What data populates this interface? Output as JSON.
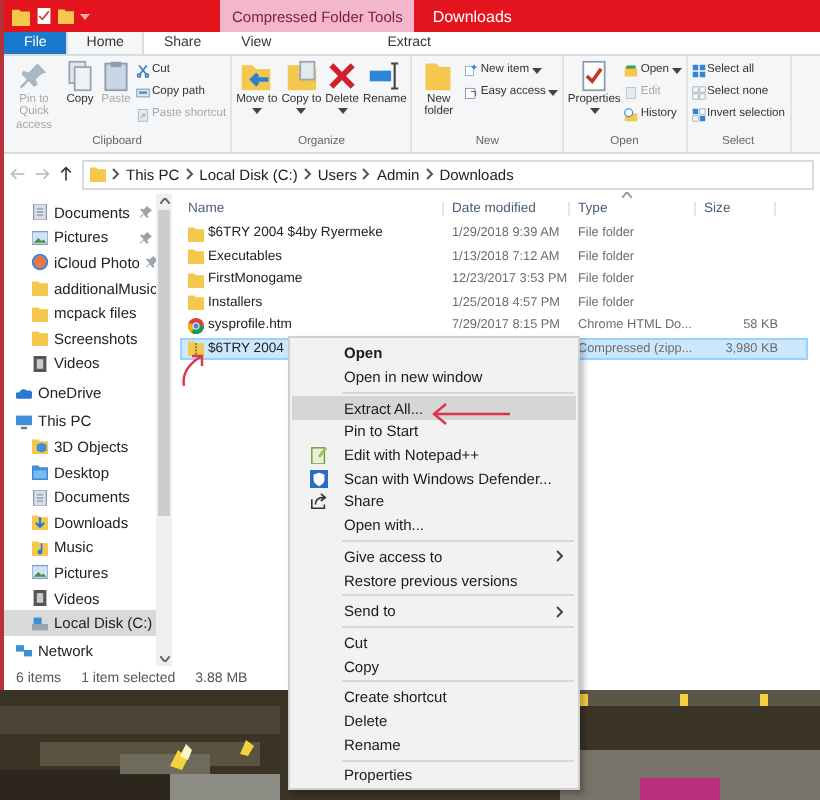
{
  "title_bar": {
    "context_tab": "Compressed Folder Tools",
    "title": "Downloads"
  },
  "ribbon_tabs": [
    {
      "label": "File",
      "kind": "file",
      "selected": false
    },
    {
      "label": "Home",
      "kind": "tab",
      "selected": true
    },
    {
      "label": "Share",
      "kind": "tab",
      "selected": false
    },
    {
      "label": "View",
      "kind": "tab",
      "selected": false
    },
    {
      "label": "Extract",
      "kind": "contextual",
      "selected": false
    }
  ],
  "ribbon_groups": [
    {
      "label": "Clipboard",
      "commands": [
        {
          "label": "Pin to Quick access",
          "kind": "large",
          "disabled": true,
          "dropdown": false
        },
        {
          "label": "Copy",
          "kind": "large",
          "disabled": false,
          "dropdown": false
        },
        {
          "label": "Paste",
          "kind": "large",
          "disabled": true,
          "dropdown": false
        },
        {
          "label": "Cut",
          "kind": "small",
          "disabled": false,
          "dropdown": false
        },
        {
          "label": "Copy path",
          "kind": "small",
          "disabled": false,
          "dropdown": false
        },
        {
          "label": "Paste shortcut",
          "kind": "small",
          "disabled": true,
          "dropdown": false
        }
      ]
    },
    {
      "label": "Organize",
      "commands": [
        {
          "label": "Move to",
          "kind": "large",
          "disabled": false,
          "dropdown": true
        },
        {
          "label": "Copy to",
          "kind": "large",
          "disabled": false,
          "dropdown": true
        },
        {
          "label": "Delete",
          "kind": "large",
          "disabled": false,
          "dropdown": true
        },
        {
          "label": "Rename",
          "kind": "large",
          "disabled": false,
          "dropdown": false
        }
      ]
    },
    {
      "label": "New",
      "commands": [
        {
          "label": "New folder",
          "kind": "large",
          "disabled": false,
          "dropdown": false
        },
        {
          "label": "New item",
          "kind": "small",
          "disabled": false,
          "dropdown": true
        },
        {
          "label": "Easy access",
          "kind": "small",
          "disabled": false,
          "dropdown": true
        }
      ]
    },
    {
      "label": "Open",
      "commands": [
        {
          "label": "Properties",
          "kind": "large",
          "disabled": false,
          "dropdown": true
        },
        {
          "label": "Open",
          "kind": "small",
          "disabled": false,
          "dropdown": true
        },
        {
          "label": "Edit",
          "kind": "small",
          "disabled": true,
          "dropdown": false
        },
        {
          "label": "History",
          "kind": "small",
          "disabled": false,
          "dropdown": false
        }
      ]
    },
    {
      "label": "Select",
      "commands": [
        {
          "label": "Select all",
          "kind": "small",
          "disabled": false,
          "dropdown": false
        },
        {
          "label": "Select none",
          "kind": "small",
          "disabled": false,
          "dropdown": false
        },
        {
          "label": "Invert selection",
          "kind": "small",
          "disabled": false,
          "dropdown": false
        }
      ]
    }
  ],
  "address_bar": {
    "nav_buttons": [
      {
        "kind": "back",
        "disabled": true
      },
      {
        "kind": "forward",
        "disabled": true
      },
      {
        "kind": "up",
        "disabled": false
      }
    ],
    "path": [
      "This PC",
      "Local Disk (C:)",
      "Users",
      "Admin",
      "Downloads"
    ]
  },
  "nav_pane": {
    "quick_access": [
      {
        "label": "Documents",
        "kind": "documents",
        "pinned": true,
        "selected": false
      },
      {
        "label": "Pictures",
        "kind": "pictures",
        "pinned": true,
        "selected": false
      },
      {
        "label": "iCloud Photo",
        "kind": "cloud",
        "pinned": true,
        "selected": false
      },
      {
        "label": "additionalMusic",
        "kind": "folder",
        "pinned": false,
        "selected": false
      },
      {
        "label": "mcpack files",
        "kind": "folder",
        "pinned": false,
        "selected": false
      },
      {
        "label": "Screenshots",
        "kind": "folder",
        "pinned": false,
        "selected": false
      },
      {
        "label": "Videos",
        "kind": "videos",
        "pinned": false,
        "selected": false
      }
    ],
    "locations": [
      {
        "label": "OneDrive",
        "kind": "onedrive",
        "selected": false
      },
      {
        "label": "This PC",
        "kind": "pc",
        "selected": false,
        "children": [
          {
            "label": "3D Objects",
            "kind": "objects",
            "selected": false
          },
          {
            "label": "Desktop",
            "kind": "desktop",
            "selected": false
          },
          {
            "label": "Documents",
            "kind": "documents",
            "selected": false
          },
          {
            "label": "Downloads",
            "kind": "downloads",
            "selected": false
          },
          {
            "label": "Music",
            "kind": "music",
            "selected": false
          },
          {
            "label": "Pictures",
            "kind": "pictures",
            "selected": false
          },
          {
            "label": "Videos",
            "kind": "videos",
            "selected": false
          },
          {
            "label": "Local Disk (C:)",
            "kind": "drive",
            "selected": true
          }
        ]
      },
      {
        "label": "Network",
        "kind": "network",
        "selected": false
      }
    ]
  },
  "file_list": {
    "columns": [
      {
        "label": "Name",
        "sorted": false
      },
      {
        "label": "Date modified",
        "sorted": false
      },
      {
        "label": "Type",
        "sorted": true
      },
      {
        "label": "Size",
        "sorted": false
      }
    ],
    "rows": [
      {
        "kind": "folder",
        "name": "$6TRY 2004 $4by Ryermeke",
        "date": "1/29/2018 9:39 AM",
        "type": "File folder",
        "selected": false
      },
      {
        "kind": "folder",
        "name": "Executables",
        "date": "1/13/2018 7:12 AM",
        "type": "File folder",
        "selected": false
      },
      {
        "kind": "folder",
        "name": "FirstMonogame",
        "date": "12/23/2017 3:53 PM",
        "type": "File folder",
        "selected": false
      },
      {
        "kind": "folder",
        "name": "Installers",
        "date": "1/25/2018 4:57 PM",
        "type": "File folder",
        "selected": false
      },
      {
        "kind": "web",
        "name": "sysprofile.htm",
        "date": "7/29/2017 8:15 PM",
        "type": "Chrome HTML Do...",
        "size": "58 KB",
        "selected": false
      },
      {
        "kind": "zip",
        "name": "$6TRY 2004",
        "type": "Compressed (zipp...",
        "size": "3,980 KB",
        "selected": true
      }
    ]
  },
  "status_bar": {
    "item_count": "6 items",
    "selection": "1 item selected",
    "size": "3.88 MB"
  },
  "context_menu": {
    "groups": [
      [
        {
          "label": "Open",
          "kind": "plain",
          "default": true,
          "selected": false,
          "submenu": false
        },
        {
          "label": "Open in new window",
          "kind": "plain",
          "default": false,
          "selected": false,
          "submenu": false
        }
      ],
      [
        {
          "label": "Extract All...",
          "kind": "plain",
          "default": false,
          "selected": true,
          "submenu": false
        },
        {
          "label": "Pin to Start",
          "kind": "plain",
          "default": false,
          "selected": false,
          "submenu": false
        },
        {
          "label": "Edit with Notepad++",
          "kind": "notepad",
          "default": false,
          "selected": false,
          "submenu": false
        },
        {
          "label": "Scan with Windows Defender...",
          "kind": "shield",
          "default": false,
          "selected": false,
          "submenu": false
        },
        {
          "label": "Share",
          "kind": "share",
          "default": false,
          "selected": false,
          "submenu": false
        },
        {
          "label": "Open with...",
          "kind": "plain",
          "default": false,
          "selected": false,
          "submenu": false
        }
      ],
      [
        {
          "label": "Give access to",
          "kind": "plain",
          "default": false,
          "selected": false,
          "submenu": true
        },
        {
          "label": "Restore previous versions",
          "kind": "plain",
          "default": false,
          "selected": false,
          "submenu": false
        }
      ],
      [
        {
          "label": "Send to",
          "kind": "plain",
          "default": false,
          "selected": false,
          "submenu": true
        }
      ],
      [
        {
          "label": "Cut",
          "kind": "plain",
          "default": false,
          "selected": false,
          "submenu": false
        },
        {
          "label": "Copy",
          "kind": "plain",
          "default": false,
          "selected": false,
          "submenu": false
        }
      ],
      [
        {
          "label": "Create shortcut",
          "kind": "plain",
          "default": false,
          "selected": false,
          "submenu": false
        },
        {
          "label": "Delete",
          "kind": "plain",
          "default": false,
          "selected": false,
          "submenu": false
        },
        {
          "label": "Rename",
          "kind": "plain",
          "default": false,
          "selected": false,
          "submenu": false
        }
      ],
      [
        {
          "label": "Properties",
          "kind": "plain",
          "default": false,
          "selected": false,
          "submenu": false
        }
      ]
    ]
  }
}
